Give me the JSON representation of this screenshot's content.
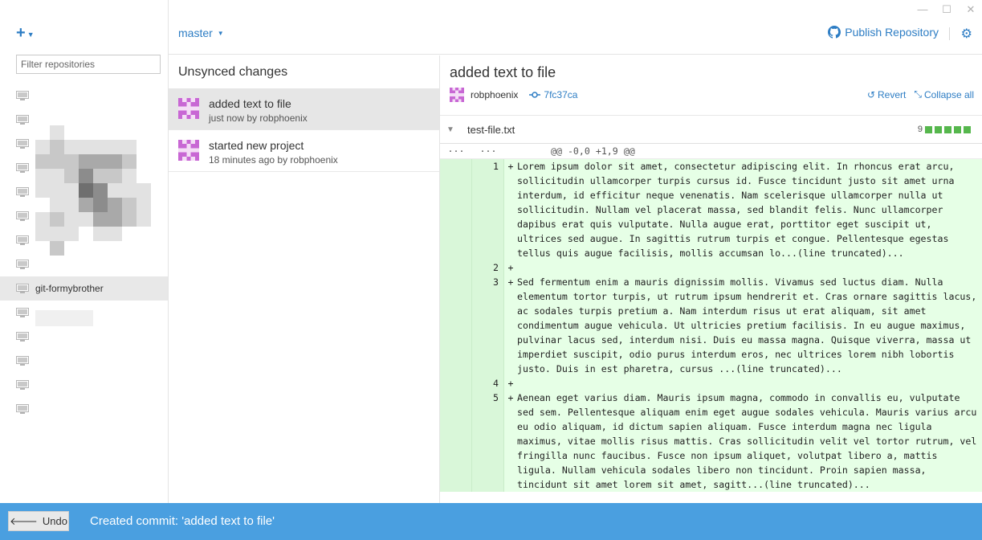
{
  "window": {
    "controls": [
      "—",
      "☐",
      "✕"
    ]
  },
  "sidebar": {
    "add_glyph": "+",
    "filter_placeholder": "Filter repositories",
    "repos": [
      {
        "label": ""
      },
      {
        "label": ""
      },
      {
        "label": ""
      },
      {
        "label": ""
      },
      {
        "label": ""
      },
      {
        "label": ""
      },
      {
        "label": ""
      },
      {
        "label": ""
      },
      {
        "label": "git-formybrother",
        "selected": true
      },
      {
        "label": ""
      },
      {
        "label": ""
      },
      {
        "label": ""
      },
      {
        "label": ""
      },
      {
        "label": ""
      }
    ]
  },
  "toolbar": {
    "branch": "master",
    "publish_label": "Publish Repository"
  },
  "history": {
    "title": "Unsynced changes",
    "commits": [
      {
        "title": "added text to file",
        "meta": "just now by robphoenix",
        "selected": true
      },
      {
        "title": "started new project",
        "meta_prefix": "18 minutes ago by",
        "author": "robphoenix"
      }
    ]
  },
  "detail": {
    "title": "added text to file",
    "author": "robphoenix",
    "sha": "7fc37ca",
    "revert_label": "Revert",
    "collapse_label": "Collapse all",
    "file": {
      "name": "test-file.txt",
      "additions": "9"
    },
    "hunk": {
      "old": "···",
      "new": "···",
      "header": "@@ -0,0 +1,9 @@"
    },
    "lines": [
      {
        "num": "1",
        "sign": "+",
        "text": "Lorem ipsum dolor sit amet, consectetur adipiscing elit. In rhoncus erat arcu, sollicitudin ullamcorper turpis cursus id. Fusce tincidunt justo sit amet urna interdum, id efficitur neque venenatis. Nam scelerisque ullamcorper nulla ut sollicitudin. Nullam vel placerat massa, sed blandit felis. Nunc ullamcorper dapibus erat quis vulputate. Nulla augue erat, porttitor eget suscipit ut, ultrices sed augue. In sagittis rutrum turpis et congue. Pellentesque egestas tellus quis augue facilisis, mollis accumsan lo...(line truncated)..."
      },
      {
        "num": "2",
        "sign": "+",
        "text": ""
      },
      {
        "num": "3",
        "sign": "+",
        "text": "Sed fermentum enim a mauris dignissim mollis. Vivamus sed luctus diam. Nulla elementum tortor turpis, ut rutrum ipsum hendrerit et. Cras ornare sagittis lacus, ac sodales turpis pretium a. Nam interdum risus ut erat aliquam, sit amet condimentum augue vehicula. Ut ultricies pretium facilisis. In eu augue maximus, pulvinar lacus sed, interdum nisi. Duis eu massa magna. Quisque viverra, massa ut imperdiet suscipit, odio purus interdum eros, nec ultrices lorem nibh lobortis justo. Duis in est pharetra, cursus ...(line truncated)..."
      },
      {
        "num": "4",
        "sign": "+",
        "text": ""
      },
      {
        "num": "5",
        "sign": "+",
        "text": "Aenean eget varius diam. Mauris ipsum magna, commodo in convallis eu, vulputate sed sem. Pellentesque aliquam enim eget augue sodales vehicula. Mauris varius arcu eu odio aliquam, id dictum sapien aliquam. Fusce interdum magna nec ligula maximus, vitae mollis risus mattis. Cras sollicitudin velit vel tortor rutrum, vel fringilla nunc faucibus. Fusce non ipsum aliquet, volutpat libero a, mattis ligula. Nullam vehicula sodales libero non tincidunt. Proin sapien massa, tincidunt sit amet lorem sit amet, sagitt...(line truncated)..."
      }
    ]
  },
  "status": {
    "undo_label": "Undo",
    "message": "Created commit: 'added text to file'"
  },
  "colors": {
    "accent": "#2d7dc4",
    "status_bar": "#4a9fe0",
    "diff_add_bg": "#e6ffe6",
    "stat_green": "#56b74d",
    "avatar": "#c867d4"
  }
}
